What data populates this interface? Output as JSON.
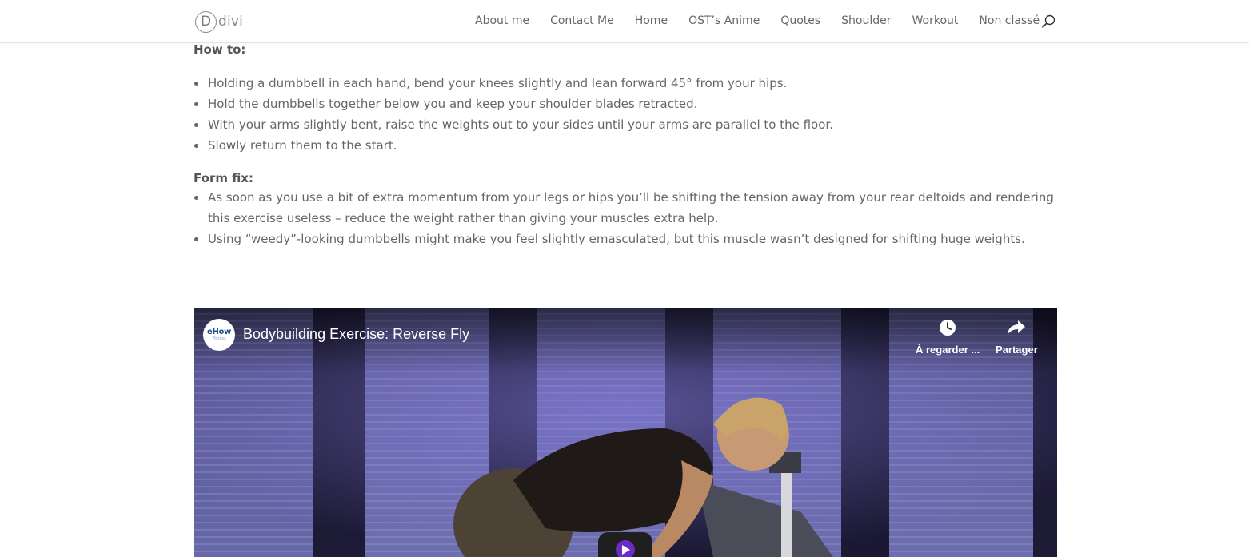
{
  "site": {
    "logo_letter": "D",
    "logo_text": "divi"
  },
  "nav": {
    "items": [
      {
        "label": "About me"
      },
      {
        "label": "Contact Me"
      },
      {
        "label": "Home"
      },
      {
        "label": "OST’s Anime"
      },
      {
        "label": "Quotes"
      },
      {
        "label": "Shoulder"
      },
      {
        "label": "Workout"
      },
      {
        "label": "Non classé"
      }
    ],
    "search_icon": "search-icon"
  },
  "content": {
    "how_to": {
      "heading": "How to:",
      "items": [
        "Holding a dumbbell in each hand, bend your knees slightly and lean forward 45° from your hips.",
        "Hold the dumbbells together below you and keep your shoulder blades retracted.",
        "With your arms slightly bent, raise the weights out to your sides until your arms are parallel to the floor.",
        "Slowly return them to the start."
      ]
    },
    "form_fix": {
      "heading": "Form fix:",
      "items": [
        "As soon as you use a bit of extra momentum from your legs or hips you’ll be shifting the tension away from your rear deltoids and rendering this exercise useless – reduce the weight rather than giving your muscles extra help.",
        "Using “weedy”-looking dumbbells might make you feel slightly emasculated, but this muscle wasn’t designed for shifting huge weights."
      ]
    }
  },
  "video": {
    "channel_brand": "eHow",
    "channel_sub": "Fitness",
    "title": "Bodybuilding Exercise: Reverse Fly",
    "watch_later_label": "À regarder ...",
    "share_label": "Partager",
    "watch_later_icon": "clock-icon",
    "share_icon": "share-arrow-icon",
    "play_icon": "play-icon"
  },
  "colors": {
    "text": "#666666",
    "heading": "#555555",
    "nav_text": "#666666",
    "video_wall": "#3c3a6e",
    "play_accent": "#6a2bc4"
  }
}
